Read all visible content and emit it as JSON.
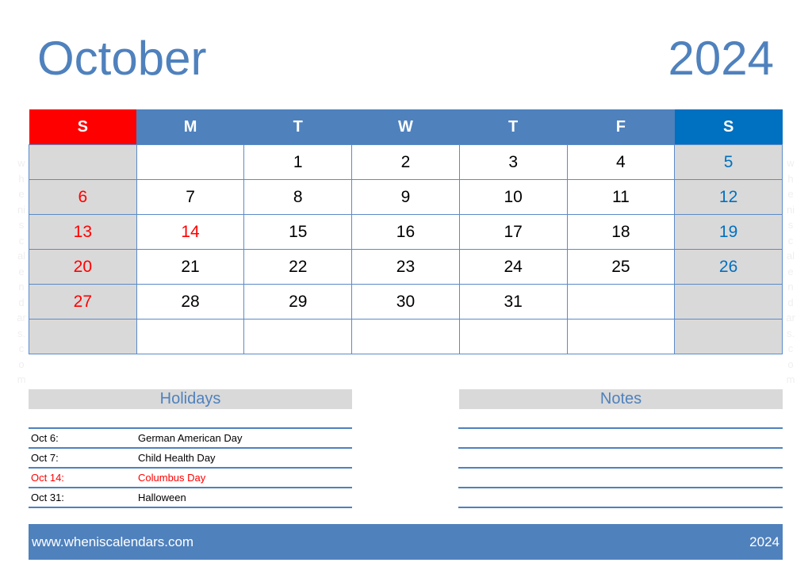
{
  "header": {
    "month": "October",
    "year": "2024"
  },
  "weekdays": [
    "S",
    "M",
    "T",
    "W",
    "T",
    "F",
    "S"
  ],
  "weeks": [
    [
      "",
      "",
      "1",
      "2",
      "3",
      "4",
      "5"
    ],
    [
      "6",
      "7",
      "8",
      "9",
      "10",
      "11",
      "12"
    ],
    [
      "13",
      "14",
      "15",
      "16",
      "17",
      "18",
      "19"
    ],
    [
      "20",
      "21",
      "22",
      "23",
      "24",
      "25",
      "26"
    ],
    [
      "27",
      "28",
      "29",
      "30",
      "31",
      "",
      ""
    ],
    [
      "",
      "",
      "",
      "",
      "",
      "",
      ""
    ]
  ],
  "highlighted_holiday_dates": [
    "14"
  ],
  "colors": {
    "accent": "#4f81bd",
    "sunday": "#ff0000",
    "saturday": "#0070c0",
    "weekend_fill": "#d9d9d9",
    "holiday_highlight": "#ff0000"
  },
  "holidays": {
    "title": "Holidays",
    "items": [
      {
        "date": "Oct 6:",
        "name": "German American Day",
        "highlight": false
      },
      {
        "date": "Oct 7:",
        "name": "Child Health Day",
        "highlight": false
      },
      {
        "date": "Oct 14:",
        "name": "Columbus Day",
        "highlight": true
      },
      {
        "date": "Oct 31:",
        "name": "Halloween",
        "highlight": false
      }
    ]
  },
  "notes": {
    "title": "Notes",
    "line_count": 5
  },
  "watermark": [
    "w",
    "h",
    "e",
    "ni",
    "s",
    "c",
    "al",
    "e",
    "n",
    "d",
    "ar",
    "s.",
    "c",
    "o",
    "m"
  ],
  "footer": {
    "url": "www.wheniscalendars.com",
    "year": "2024"
  }
}
